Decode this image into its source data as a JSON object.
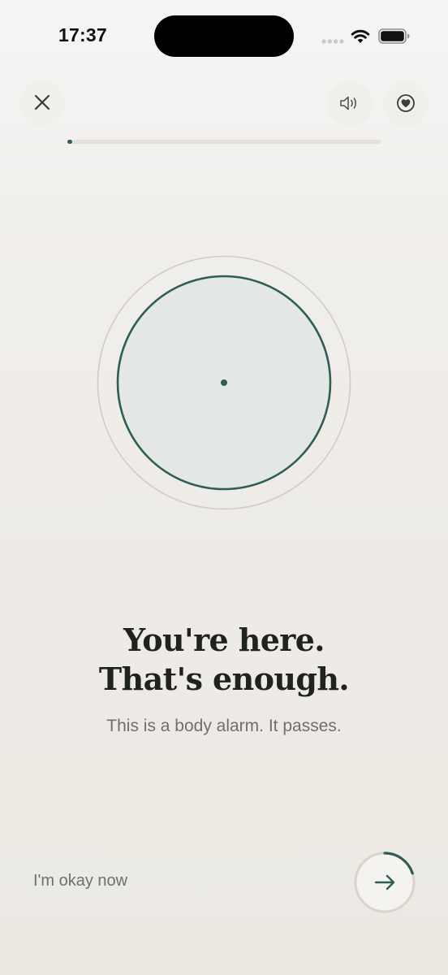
{
  "status_bar": {
    "time": "17:37"
  },
  "controls": {
    "close_icon": "close-icon",
    "sound_icon": "speaker-icon",
    "favorite_icon": "heart-icon"
  },
  "session": {
    "progress": 0.015,
    "countdown_progress": 0.2
  },
  "content": {
    "headline_line1": "You're here.",
    "headline_line2": "That's enough.",
    "subtext": "This is a body alarm. It passes."
  },
  "footer": {
    "okay_label": "I'm okay now",
    "next_icon": "arrow-right-icon"
  },
  "colors": {
    "accent": "#2f5e57",
    "circle_fill": "#e3e8e4",
    "outer_ring": "#cfccc6",
    "text_primary": "#1f221f",
    "text_secondary": "#6e706c"
  }
}
